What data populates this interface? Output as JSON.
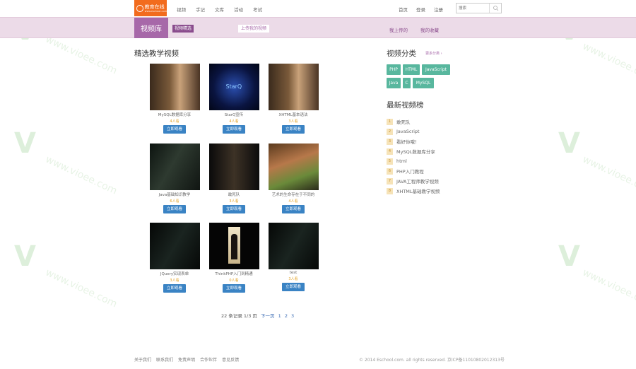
{
  "header": {
    "logo_text": "教育在线",
    "logo_sub": "www.eschool.com",
    "nav": [
      "视频",
      "手记",
      "文库",
      "活动",
      "考试"
    ],
    "user_links": [
      "首页",
      "登录",
      "注册"
    ],
    "search_placeholder": "搜索"
  },
  "band": {
    "title": "视频库",
    "tag": "视频精选",
    "upload": "上传我的视频",
    "links": [
      "我上传的",
      "我的收藏"
    ]
  },
  "main": {
    "title": "精选教学视频",
    "videos": [
      {
        "title": "MySQL数据库分享",
        "views": "4人看",
        "button": "立即观看"
      },
      {
        "title": "StarQ宣传",
        "views": "4人看",
        "button": "立即观看"
      },
      {
        "title": "XHTML基本语法",
        "views": "3人看",
        "button": "立即观看"
      },
      {
        "title": "Java基础知识教学",
        "views": "6人看",
        "button": "立即观看"
      },
      {
        "title": "敢死队",
        "views": "3人看",
        "button": "立即观看"
      },
      {
        "title": "艺术的生命存在于不同的",
        "views": "4人看",
        "button": "立即观看"
      },
      {
        "title": "JQuery实现表单",
        "views": "3人看",
        "button": "立即观看"
      },
      {
        "title": "ThinkPHP入门到精通",
        "views": "0人看",
        "button": "立即观看"
      },
      {
        "title": "test",
        "views": "3人看",
        "button": "立即观看"
      }
    ],
    "pager": {
      "summary": "22 条记录 1/3 页",
      "next": "下一页",
      "pages": [
        "1",
        "2",
        "3"
      ]
    }
  },
  "sidebar": {
    "category_title": "视频分类",
    "category_more": "更多分类 ›",
    "categories": [
      "PHP",
      "HTML",
      "JavaScript",
      "Java",
      "C",
      "MySQL"
    ],
    "rank_title": "最新视频榜",
    "rank": [
      "敢死队",
      "JavaScript",
      "看好你哦！",
      "MySQL数据库分享",
      "html",
      "PHP入门教程",
      "JAVA工程师教学视频",
      "XHTML基础教学视频"
    ]
  },
  "footer": {
    "links": [
      "关于我们",
      "联系我们",
      "免责声明",
      "合作伙伴",
      "意见反馈"
    ],
    "copyright": "© 2014 Eschool.com. all rights reserved. 京ICP备11010802012313号"
  },
  "colors": {
    "accent": "#a768a9",
    "play": "#3a83c4",
    "tag": "#58b79e",
    "logo": "#f26b1d"
  }
}
